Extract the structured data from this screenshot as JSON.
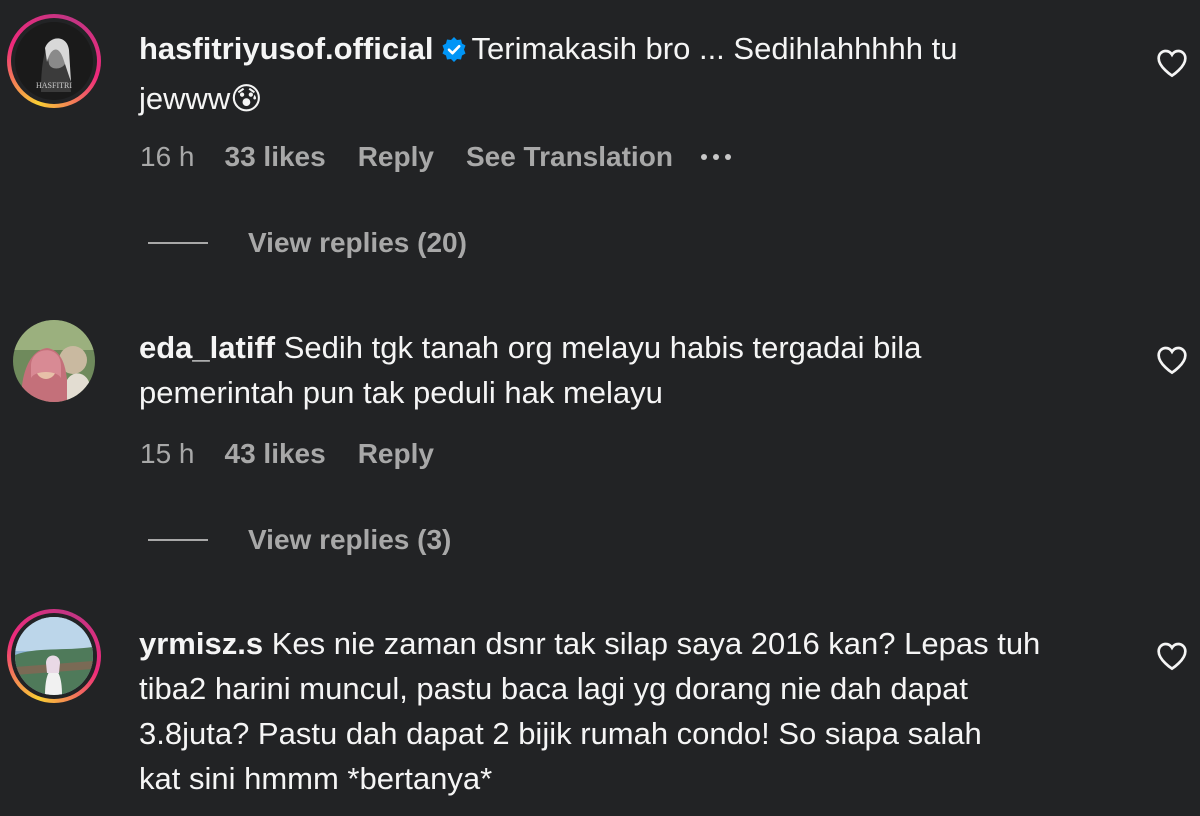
{
  "comments": [
    {
      "username": "hasfitriyusof.official",
      "verified": true,
      "text_line1": "Terimakasih bro ... Sedihlahhhhh tu",
      "text_line2": "jewww",
      "emoji": "😰",
      "time": "16 h",
      "likes": "33 likes",
      "reply_label": "Reply",
      "translate_label": "See Translation",
      "view_replies": "View replies (20)",
      "avatar_caption": "HASFITRI"
    },
    {
      "username": "eda_latiff",
      "verified": false,
      "text_line1": "Sedih tgk tanah org melayu habis tergadai bila",
      "text_line2": "pemerintah pun tak peduli hak melayu",
      "time": "15 h",
      "likes": "43 likes",
      "reply_label": "Reply",
      "view_replies": "View replies (3)"
    },
    {
      "username": "yrmisz.s",
      "verified": false,
      "text_line1": "Kes nie zaman dsnr tak silap saya 2016 kan? Lepas tuh",
      "text_line2": "tiba2 harini muncul, pastu baca lagi yg dorang nie dah dapat",
      "text_line3": "3.8juta? Pastu dah dapat 2 bijik rumah condo! So siapa salah",
      "text_line4": "kat sini hmmm *bertanya*"
    }
  ],
  "colors": {
    "background": "#222325",
    "text": "#f5f5f5",
    "secondary_text": "#a8a8a8",
    "verified_badge": "#0095f6"
  }
}
